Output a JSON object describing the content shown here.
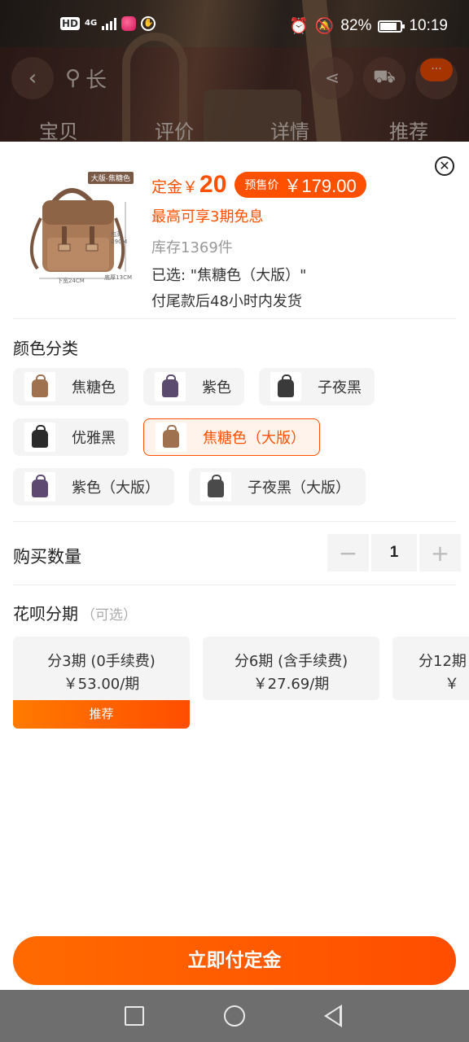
{
  "status_bar": {
    "hd": "HD",
    "network": "4G",
    "battery": "82%",
    "time": "10:19"
  },
  "background_page": {
    "search_text": "长",
    "tabs": [
      "宝贝",
      "评价",
      "详情",
      "推荐"
    ],
    "badge": "···"
  },
  "product": {
    "image_tag": "大版-焦糖色",
    "dim_height": "包高\n29CM",
    "dim_width": "下宽24CM",
    "dim_depth": "底厚13CM",
    "deposit_label": "定金￥",
    "deposit_value": "20",
    "presale_label": "预售价",
    "presale_price": "￥179.00",
    "installment_note": "最高可享3期免息",
    "stock": "库存1369件",
    "selected": "已选: \"焦糖色（大版）\"",
    "shipping": "付尾款后48小时内发货"
  },
  "color_section": {
    "title": "颜色分类",
    "options": [
      {
        "label": "焦糖色",
        "color": "#a0714f"
      },
      {
        "label": "紫色",
        "color": "#5a4a6e"
      },
      {
        "label": "子夜黑",
        "color": "#3a3a3a"
      },
      {
        "label": "优雅黑",
        "color": "#2a2a2a"
      },
      {
        "label": "焦糖色（大版）",
        "color": "#a0714f"
      },
      {
        "label": "紫色（大版）",
        "color": "#5e4a70"
      },
      {
        "label": "子夜黑（大版）",
        "color": "#4a4a4a"
      }
    ],
    "selected_index": 4
  },
  "quantity": {
    "title": "购买数量",
    "minus": "−",
    "value": "1",
    "plus": "+"
  },
  "huabei": {
    "title": "花呗分期",
    "optional": "（可选）",
    "plans": [
      {
        "term": "分3期 (0手续费)",
        "price": "￥53.00/期"
      },
      {
        "term": "分6期 (含手续费)",
        "price": "￥27.69/期"
      },
      {
        "term": "分12期",
        "price": "￥"
      }
    ],
    "recommend_label": "推荐"
  },
  "cta": {
    "label": "立即付定金"
  },
  "colors": {
    "accent": "#ff5000"
  }
}
